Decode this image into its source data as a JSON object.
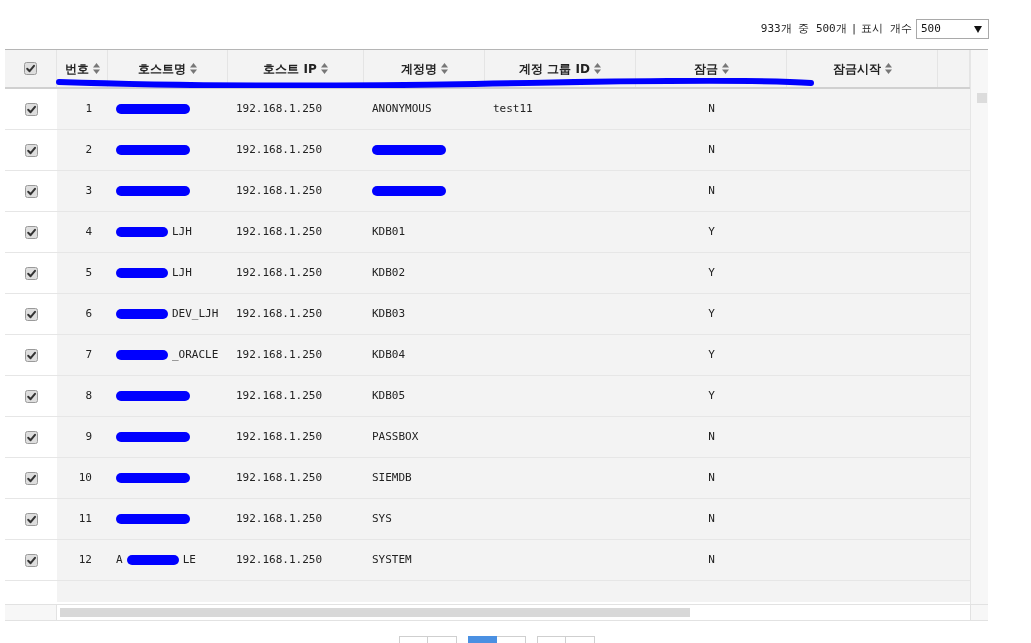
{
  "toolbar": {
    "record_count": "933개 중 500개",
    "separator": "|",
    "page_size_label": "표시 개수",
    "page_size": {
      "value": "500"
    }
  },
  "table": {
    "header_redacted": true,
    "select_all": {
      "checked": true
    },
    "columns": [
      {
        "label": "번호"
      },
      {
        "label": "호스트명"
      },
      {
        "label": "호스트 IP"
      },
      {
        "label": "계정명"
      },
      {
        "label": "계정 그룹 ID"
      },
      {
        "label": "잠금"
      },
      {
        "label": "잠금시작"
      }
    ],
    "rows": [
      {
        "checked": true,
        "no": "1",
        "host_name": {
          "redacted": true
        },
        "host_ip": "192.168.1.250",
        "account": "ANONYMOUS",
        "group_id": "test11",
        "locked": "N"
      },
      {
        "checked": true,
        "no": "2",
        "host_name": {
          "redacted": true
        },
        "host_ip": "192.168.1.250",
        "account": {
          "redacted": true
        },
        "locked": "N"
      },
      {
        "checked": true,
        "no": "3",
        "host_name": {
          "redacted": true
        },
        "host_ip": "192.168.1.250",
        "account": {
          "redacted": true
        },
        "locked": "N"
      },
      {
        "checked": true,
        "no": "4",
        "host_name": {
          "redacted": true,
          "after": "LJH"
        },
        "host_ip": "192.168.1.250",
        "account": "KDB01",
        "locked": "Y"
      },
      {
        "checked": true,
        "no": "5",
        "host_name": {
          "redacted": true,
          "after": "LJH"
        },
        "host_ip": "192.168.1.250",
        "account": "KDB02",
        "locked": "Y"
      },
      {
        "checked": true,
        "no": "6",
        "host_name": {
          "redacted": true,
          "after": "DEV_LJH"
        },
        "host_ip": "192.168.1.250",
        "account": "KDB03",
        "locked": "Y"
      },
      {
        "checked": true,
        "no": "7",
        "host_name": {
          "redacted": true,
          "after": "_ORACLE"
        },
        "host_ip": "192.168.1.250",
        "account": "KDB04",
        "locked": "Y"
      },
      {
        "checked": true,
        "no": "8",
        "host_name": {
          "redacted": true
        },
        "host_ip": "192.168.1.250",
        "account": "KDB05",
        "locked": "Y"
      },
      {
        "checked": true,
        "no": "9",
        "host_name": {
          "redacted": true
        },
        "host_ip": "192.168.1.250",
        "account": "PASSBOX",
        "locked": "N"
      },
      {
        "checked": true,
        "no": "10",
        "host_name": {
          "redacted": true
        },
        "host_ip": "192.168.1.250",
        "account": "SIEMDB",
        "locked": "N"
      },
      {
        "checked": true,
        "no": "11",
        "host_name": {
          "redacted": true
        },
        "host_ip": "192.168.1.250",
        "account": "SYS",
        "locked": "N"
      },
      {
        "checked": true,
        "no": "12",
        "host_name": {
          "redacted": true,
          "before": "A",
          "after": "LE"
        },
        "host_ip": "192.168.1.250",
        "account": "SYSTEM",
        "locked": "N"
      }
    ]
  },
  "pagination": {
    "groups": [
      [
        {
          "selected": false
        },
        {
          "selected": false
        }
      ],
      [
        {
          "selected": true
        },
        {
          "selected": false
        }
      ],
      [
        {
          "selected": false
        },
        {
          "selected": false
        }
      ]
    ]
  }
}
